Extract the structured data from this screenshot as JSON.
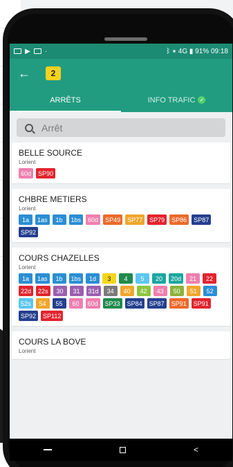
{
  "status_bar": {
    "right": "ᛒ ✶ 4G ▮ 91% 09:18"
  },
  "header": {
    "count": "2"
  },
  "tabs": [
    {
      "label": "ARRÊTS"
    },
    {
      "label": "INFO TRAFIC"
    }
  ],
  "search": {
    "placeholder": "Arrêt"
  },
  "stops": [
    {
      "name": "BELLE SOURCE",
      "city": "Lorient",
      "lines": [
        {
          "label": "60d",
          "color": "#ef7fae"
        },
        {
          "label": "SP90",
          "color": "#e2242d"
        }
      ]
    },
    {
      "name": "CHBRE METIERS",
      "city": "Lorient",
      "lines": [
        {
          "label": "1a",
          "color": "#2a8ed4"
        },
        {
          "label": "1as",
          "color": "#2a8ed4"
        },
        {
          "label": "1b",
          "color": "#2a8ed4"
        },
        {
          "label": "1bs",
          "color": "#2a8ed4"
        },
        {
          "label": "60d",
          "color": "#ef7fae"
        },
        {
          "label": "SP49",
          "color": "#ed6a2b"
        },
        {
          "label": "SP77",
          "color": "#f0a62c"
        },
        {
          "label": "SP79",
          "color": "#e2242d"
        },
        {
          "label": "SP86",
          "color": "#ed6a2b"
        },
        {
          "label": "SP87",
          "color": "#243f8f"
        },
        {
          "label": "SP92",
          "color": "#243f8f"
        }
      ]
    },
    {
      "name": "COURS CHAZELLES",
      "city": "Lorient",
      "lines": [
        {
          "label": "1a",
          "color": "#2a8ed4"
        },
        {
          "label": "1as",
          "color": "#2a8ed4"
        },
        {
          "label": "1b",
          "color": "#2a8ed4"
        },
        {
          "label": "1bs",
          "color": "#2a8ed4"
        },
        {
          "label": "1d",
          "color": "#2a8ed4"
        },
        {
          "label": "3",
          "color": "#f7d51b",
          "dark": true
        },
        {
          "label": "4",
          "color": "#1f8a4c"
        },
        {
          "label": "5",
          "color": "#5cc7f0"
        },
        {
          "label": "20",
          "color": "#1aa6a0"
        },
        {
          "label": "20d",
          "color": "#1aa6a0"
        },
        {
          "label": "21",
          "color": "#ef7fae"
        },
        {
          "label": "22",
          "color": "#e2242d"
        },
        {
          "label": "22d",
          "color": "#e2242d"
        },
        {
          "label": "22s",
          "color": "#e2242d"
        },
        {
          "label": "30",
          "color": "#9b5fb0"
        },
        {
          "label": "31",
          "color": "#9b5fb0"
        },
        {
          "label": "31d",
          "color": "#9b5fb0"
        },
        {
          "label": "34",
          "color": "#7a7a7a"
        },
        {
          "label": "40",
          "color": "#f0a62c"
        },
        {
          "label": "42",
          "color": "#8cc63f"
        },
        {
          "label": "43",
          "color": "#ef7fae"
        },
        {
          "label": "50",
          "color": "#8cb33c"
        },
        {
          "label": "51",
          "color": "#f0a62c"
        },
        {
          "label": "52",
          "color": "#2a8ed4"
        },
        {
          "label": "52s",
          "color": "#5cc7f0"
        },
        {
          "label": "54",
          "color": "#f0a62c"
        },
        {
          "label": "55",
          "color": "#243f8f"
        },
        {
          "label": "60",
          "color": "#ef7fae"
        },
        {
          "label": "60d",
          "color": "#ef7fae"
        },
        {
          "label": "SP33",
          "color": "#1f8a4c"
        },
        {
          "label": "SP84",
          "color": "#243f8f"
        },
        {
          "label": "SP87",
          "color": "#243f8f"
        },
        {
          "label": "SP91",
          "color": "#ed6a2b"
        },
        {
          "label": "SP91",
          "color": "#e2242d"
        },
        {
          "label": "SP92",
          "color": "#243f8f"
        },
        {
          "label": "SP112",
          "color": "#e2242d"
        }
      ]
    },
    {
      "name": "COURS LA BOVE",
      "city": "Lorient",
      "lines": []
    }
  ]
}
